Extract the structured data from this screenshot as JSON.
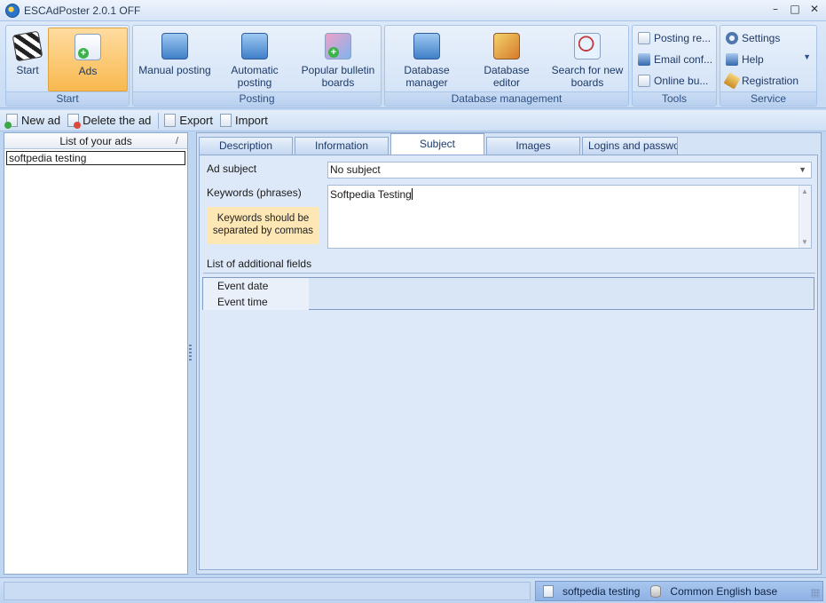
{
  "window": {
    "title": "ESCAdPoster 2.0.1 OFF",
    "minimize": "–",
    "maximize": "□",
    "close": "✕"
  },
  "ribbon": {
    "groups": {
      "start": {
        "label": "Start",
        "buttons": {
          "start": "Start",
          "ads": "Ads"
        }
      },
      "posting": {
        "label": "Posting",
        "buttons": {
          "manual": "Manual posting",
          "automatic": "Automatic posting",
          "popular": "Popular bulletin boards"
        }
      },
      "database": {
        "label": "Database management",
        "buttons": {
          "manager": "Database manager",
          "editor": "Database editor",
          "search": "Search for new boards"
        }
      },
      "tools": {
        "label": "Tools",
        "items": [
          "Posting re...",
          "Email conf...",
          "Online bu..."
        ]
      },
      "service": {
        "label": "Service",
        "items": [
          "Settings",
          "Help",
          "Registration"
        ]
      }
    }
  },
  "toolbar": {
    "new_ad": "New ad",
    "delete_ad": "Delete the ad",
    "export": "Export",
    "import": "Import"
  },
  "ads_list": {
    "header": "List of your ads",
    "sort_glyph": "/",
    "items": [
      "softpedia testing"
    ]
  },
  "tabs": [
    "Description",
    "Information",
    "Subject",
    "Images",
    "Logins and passwo..."
  ],
  "active_tab": "Subject",
  "subject": {
    "ad_subject_label": "Ad subject",
    "ad_subject_value": "No subject",
    "keywords_label": "Keywords (phrases)",
    "keywords_value": "Softpedia Testing",
    "keywords_hint": "Keywords should be separated by commas",
    "additional_fields_label": "List of additional fields",
    "additional_fields": [
      "Event date",
      "Event time"
    ]
  },
  "status": {
    "ad_name": "softpedia testing",
    "database": "Common English base"
  }
}
